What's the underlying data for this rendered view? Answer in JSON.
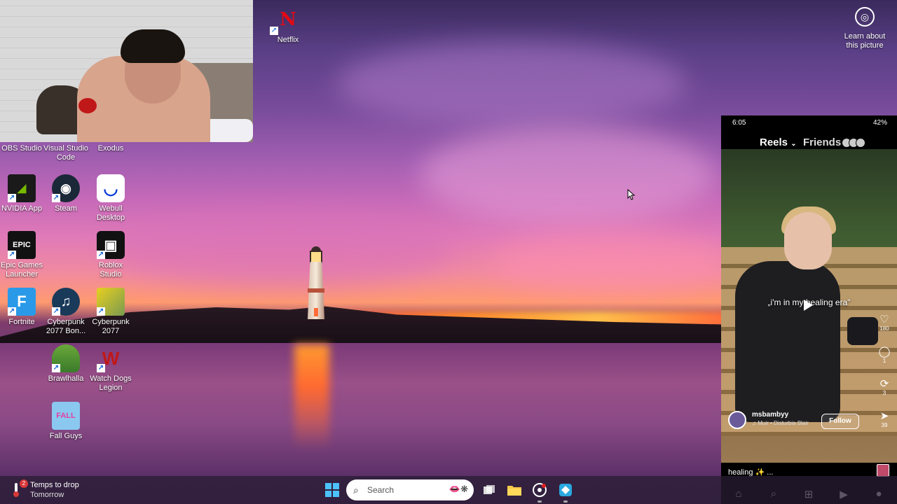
{
  "desktop": {
    "icons": [
      {
        "key": "netflix",
        "label": "Netflix",
        "glyph": "N",
        "bg": "transparent",
        "fg": "#e50914"
      },
      {
        "key": "obs",
        "label": "OBS Studio",
        "glyph": "",
        "bg": "#222",
        "fg": "#fff"
      },
      {
        "key": "vscode",
        "label": "Visual Studio Code",
        "glyph": "",
        "bg": "#1e6fd0",
        "fg": "#fff"
      },
      {
        "key": "exodus",
        "label": "Exodus",
        "glyph": "",
        "bg": "#5a3ac0",
        "fg": "#fff"
      },
      {
        "key": "nvidia",
        "label": "NVIDIA App",
        "glyph": "nv",
        "bg": "#1a1a1a",
        "fg": "#76b900"
      },
      {
        "key": "steam",
        "label": "Steam",
        "glyph": "◉",
        "bg": "#1b2838",
        "fg": "#fff"
      },
      {
        "key": "webull",
        "label": "Webull Desktop",
        "glyph": "◡",
        "bg": "#ffffff",
        "fg": "#0a3ad8"
      },
      {
        "key": "epic",
        "label": "Epic Games Launcher",
        "glyph": "EPIC",
        "bg": "#111",
        "fg": "#fff"
      },
      {
        "key": "roblox",
        "label": "Roblox Studio",
        "glyph": "▣",
        "bg": "#111",
        "fg": "#fff"
      },
      {
        "key": "fortnite",
        "label": "Fortnite",
        "glyph": "F",
        "bg": "#2a9ae8",
        "fg": "#fff"
      },
      {
        "key": "cp2077bonus",
        "label": "Cyberpunk 2077 Bon...",
        "glyph": "♫",
        "bg": "#1a3a5a",
        "fg": "#fff"
      },
      {
        "key": "cp2077",
        "label": "Cyberpunk 2077",
        "glyph": "",
        "bg": "#e8d020",
        "fg": "#222"
      },
      {
        "key": "brawlhalla",
        "label": "Brawlhalla",
        "glyph": "",
        "bg": "#3a8a3a",
        "fg": "#fff"
      },
      {
        "key": "watchdogs",
        "label": "Watch Dogs Legion",
        "glyph": "W",
        "bg": "transparent",
        "fg": "#c01818"
      },
      {
        "key": "fallguys",
        "label": "Fall Guys",
        "glyph": "FALL",
        "bg": "#8ac8f0",
        "fg": "#e040a0"
      }
    ],
    "learn_about": "Learn about this picture"
  },
  "phone": {
    "status_time": "6:05",
    "status_battery": "42%",
    "tab_reels": "Reels",
    "tab_friends": "Friends",
    "caption": "„i'm in my healing era\"",
    "side": [
      {
        "icon": "♡",
        "count": "180"
      },
      {
        "icon": "◯",
        "count": "1"
      },
      {
        "icon": "⟳",
        "count": "3"
      },
      {
        "icon": "➤",
        "count": "39"
      }
    ],
    "username": "msbambyy",
    "music": "♫ Muir • Disturbia   Blair",
    "follow": "Follow",
    "description": "healing ✨ ..."
  },
  "taskbar": {
    "weather_badge": "2",
    "weather_line1": "Temps to drop",
    "weather_line2": "Tomorrow",
    "search_placeholder": "Search"
  }
}
